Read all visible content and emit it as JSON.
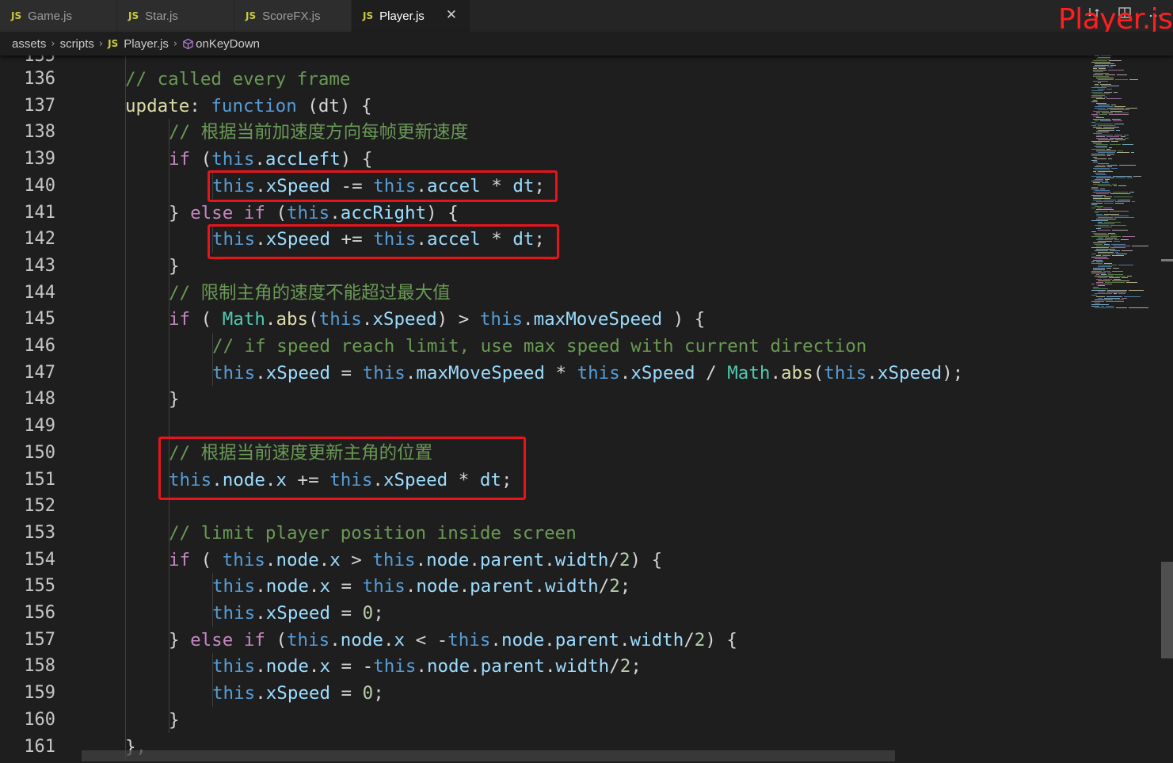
{
  "tabs": [
    {
      "icon": "JS",
      "label": "Game.js"
    },
    {
      "icon": "JS",
      "label": "Star.js"
    },
    {
      "icon": "JS",
      "label": "ScoreFX.js"
    },
    {
      "icon": "JS",
      "label": "Player.js",
      "close": "✕"
    }
  ],
  "overlay_title": "Player.js",
  "breadcrumb": {
    "items": [
      "assets",
      "scripts",
      "Player.js",
      "onKeyDown"
    ],
    "file_icon": "JS",
    "symbol_icon": "symbol-method-icon"
  },
  "top_icons": [
    "open-changes-icon",
    "split-editor-icon",
    "more-actions-icon"
  ],
  "line_numbers": [
    "136",
    "137",
    "138",
    "139",
    "140",
    "141",
    "142",
    "143",
    "144",
    "145",
    "146",
    "147",
    "148",
    "149",
    "150",
    "151",
    "152",
    "153",
    "154",
    "155",
    "156",
    "157",
    "158",
    "159",
    "160",
    "161"
  ],
  "code": {
    "l136": "// called every frame",
    "l137": [
      "update",
      ": ",
      "function",
      " (dt) {"
    ],
    "l138": "// 根据当前加速度方向每帧更新速度",
    "l139": [
      "if",
      " (",
      "this",
      ".",
      "accLeft",
      ") {"
    ],
    "l140": [
      "this",
      ".",
      "xSpeed",
      " -= ",
      "this",
      ".",
      "accel",
      " * ",
      "dt",
      ";"
    ],
    "l141": [
      "} ",
      "else",
      " ",
      "if",
      " (",
      "this",
      ".",
      "accRight",
      ") {"
    ],
    "l142": [
      "this",
      ".",
      "xSpeed",
      " += ",
      "this",
      ".",
      "accel",
      " * ",
      "dt",
      ";"
    ],
    "l143": "}",
    "l144": "// 限制主角的速度不能超过最大值",
    "l145": [
      "if",
      " ( ",
      "Math",
      ".",
      "abs",
      "(",
      "this",
      ".",
      "xSpeed",
      ") > ",
      "this",
      ".",
      "maxMoveSpeed",
      " ) {"
    ],
    "l146": "// if speed reach limit, use max speed with current direction",
    "l147": [
      "this",
      ".",
      "xSpeed",
      " = ",
      "this",
      ".",
      "maxMoveSpeed",
      " * ",
      "this",
      ".",
      "xSpeed",
      " / ",
      "Math",
      ".",
      "abs",
      "(",
      "this",
      ".",
      "xSpeed",
      ");"
    ],
    "l148": "}",
    "l150": "// 根据当前速度更新主角的位置",
    "l151": [
      "this",
      ".",
      "node",
      ".",
      "x",
      " += ",
      "this",
      ".",
      "xSpeed",
      " * ",
      "dt",
      ";"
    ],
    "l153": "// limit player position inside screen",
    "l154": [
      "if",
      " ( ",
      "this",
      ".",
      "node",
      ".",
      "x",
      " > ",
      "this",
      ".",
      "node",
      ".",
      "parent",
      ".",
      "width",
      "/",
      "2",
      ") {"
    ],
    "l155": [
      "this",
      ".",
      "node",
      ".",
      "x",
      " = ",
      "this",
      ".",
      "node",
      ".",
      "parent",
      ".",
      "width",
      "/",
      "2",
      ";"
    ],
    "l156": [
      "this",
      ".",
      "xSpeed",
      " = ",
      "0",
      ";"
    ],
    "l157": [
      "} ",
      "else",
      " ",
      "if",
      " (",
      "this",
      ".",
      "node",
      ".",
      "x",
      " < -",
      "this",
      ".",
      "node",
      ".",
      "parent",
      ".",
      "width",
      "/",
      "2",
      ") {"
    ],
    "l158": [
      "this",
      ".",
      "node",
      ".",
      "x",
      " = -",
      "this",
      ".",
      "node",
      ".",
      "parent",
      ".",
      "width",
      "/",
      "2",
      ";"
    ],
    "l159": [
      "this",
      ".",
      "xSpeed",
      " = ",
      "0",
      ";"
    ],
    "l160": "}",
    "l161": "},"
  },
  "colors": {
    "comment": "#6a9955",
    "keyword": "#c586c0",
    "this": "#569cd6",
    "property": "#9cdcfe",
    "method": "#dcdcaa",
    "class": "#4ec9b0",
    "number": "#b5cea8",
    "highlight_box": "#e8141c",
    "overlay_title": "#ff1f1f"
  }
}
